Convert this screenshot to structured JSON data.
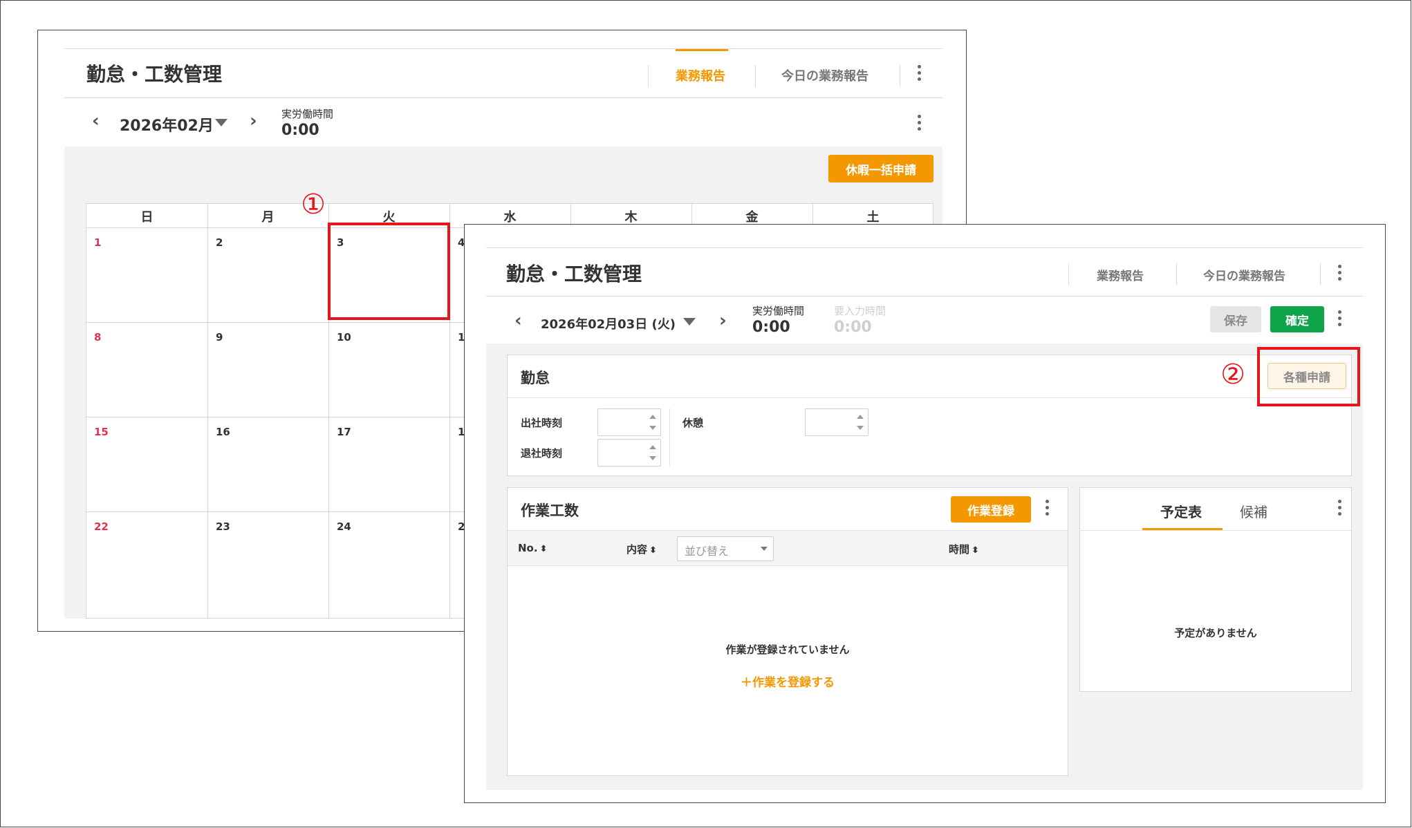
{
  "app_title": "勤怠・工数管理",
  "tabs": {
    "report": "業務報告",
    "today_report": "今日の業務報告"
  },
  "calendar_screen": {
    "month": "2026年02月",
    "actual_hours_label": "実労働時間",
    "actual_hours_value": "0:00",
    "bulk_leave_button": "休暇一括申請",
    "weekdays": [
      "日",
      "月",
      "火",
      "水",
      "木",
      "金",
      "土"
    ],
    "rows": [
      [
        "1",
        "2",
        "3",
        "4"
      ],
      [
        "8",
        "9",
        "10",
        "1"
      ],
      [
        "15",
        "16",
        "17",
        "1"
      ],
      [
        "22",
        "23",
        "24",
        "2"
      ]
    ]
  },
  "day_screen": {
    "date": "2026年02月03日 (火)",
    "actual_hours_label": "実労働時間",
    "actual_hours_value": "0:00",
    "required_input_label": "要入力時間",
    "required_input_value": "0:00",
    "save_button": "保存",
    "confirm_button": "確定",
    "attendance": {
      "section_title": "勤怠",
      "requests_button": "各種申請",
      "clock_in_label": "出社時刻",
      "clock_out_label": "退社時刻",
      "break_label": "休憩"
    },
    "work": {
      "section_title": "作業工数",
      "register_button": "作業登録",
      "col_no": "No.",
      "col_content": "内容",
      "sort_placeholder": "並び替え",
      "col_time": "時間",
      "empty_message": "作業が登録されていません",
      "register_link": "＋作業を登録する"
    },
    "schedule": {
      "tab_schedule": "予定表",
      "tab_candidates": "候補",
      "empty_message": "予定がありません"
    }
  },
  "annotations": {
    "step1": "①",
    "step2": "②"
  },
  "colors": {
    "accent": "#f39800",
    "confirm": "#0ea44a",
    "highlight": "#e8141c",
    "sunday": "#e0334d"
  }
}
